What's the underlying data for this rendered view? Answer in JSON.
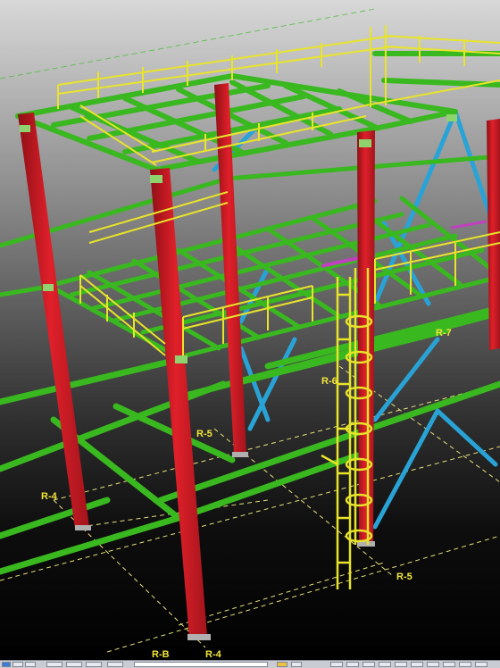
{
  "viewport": {
    "colors": {
      "column": "#e0202a",
      "beam": "#39b81f",
      "handrail": "#e8e42a",
      "brace": "#29a3d6",
      "accent_member": "#c040c0",
      "grid_line": "#e8e07a"
    },
    "grid_labels": [
      "R-4",
      "R-5",
      "R-6",
      "R-7",
      "R-5",
      "R-B",
      "R-4"
    ]
  },
  "statusbar": {
    "left_icon": "windows-icon",
    "buttons": [
      "toolbar-button",
      "toolbar-button",
      "toolbar-button",
      "toolbar-button",
      "toolbar-button",
      "toolbar-button"
    ]
  }
}
